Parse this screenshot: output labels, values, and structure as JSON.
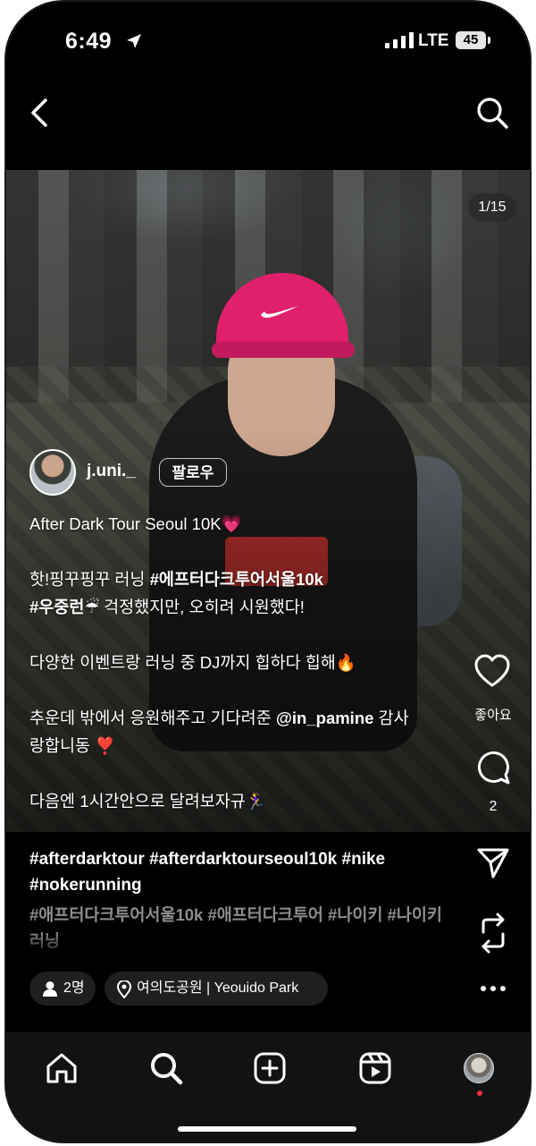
{
  "status_bar": {
    "time": "6:49",
    "network": "LTE",
    "battery": "45"
  },
  "photo": {
    "counter": "1/15"
  },
  "author": {
    "username": "j.uni._",
    "follow_label": "팔로우"
  },
  "caption": {
    "line1": "After Dark Tour Seoul 10K💗",
    "line2_text": "핫!핑꾸핑꾸 러닝 ",
    "line2_tag": "#에프터다크투어서울10k",
    "line3_tag": "#우중런☔",
    "line3_text": " 걱정했지만, 오히려 시원했다!",
    "line4": "다양한 이벤트랑 러닝 중 DJ까지 힙하다 힙해🔥",
    "line5_text": "추운데 밖에서 응원해주고 기다려준 ",
    "line5_mention": "@in_pamine",
    "line5_tail": " 감사",
    "line6": "랑합니동 ❣️",
    "line7": "다음엔 1시간안으로 달려보자규🏃‍♀️"
  },
  "hashtags": {
    "primary": "#afterdarktour #afterdarktourseoul10k #nike #nokerunning",
    "secondary": "#애프터다크투어서울10k #애프터다크투어 #나이키 #나이키러닝"
  },
  "actions": {
    "like_label": "좋아요",
    "comment_count": "2"
  },
  "chips": {
    "people": "2명",
    "location": "여의도공원 | Yeouido Park"
  },
  "icons": [
    "back-arrow-icon",
    "search-icon",
    "heart-icon",
    "comment-icon",
    "send-icon",
    "repost-icon",
    "more-icon",
    "home-icon",
    "explore-icon",
    "create-icon",
    "reels-icon",
    "person-icon",
    "location-pin-icon"
  ],
  "colors": {
    "background": "#000000",
    "cap_pink": "#e0206b",
    "notification_dot": "#ff3040",
    "secondary_text": "#8e8e8e"
  }
}
